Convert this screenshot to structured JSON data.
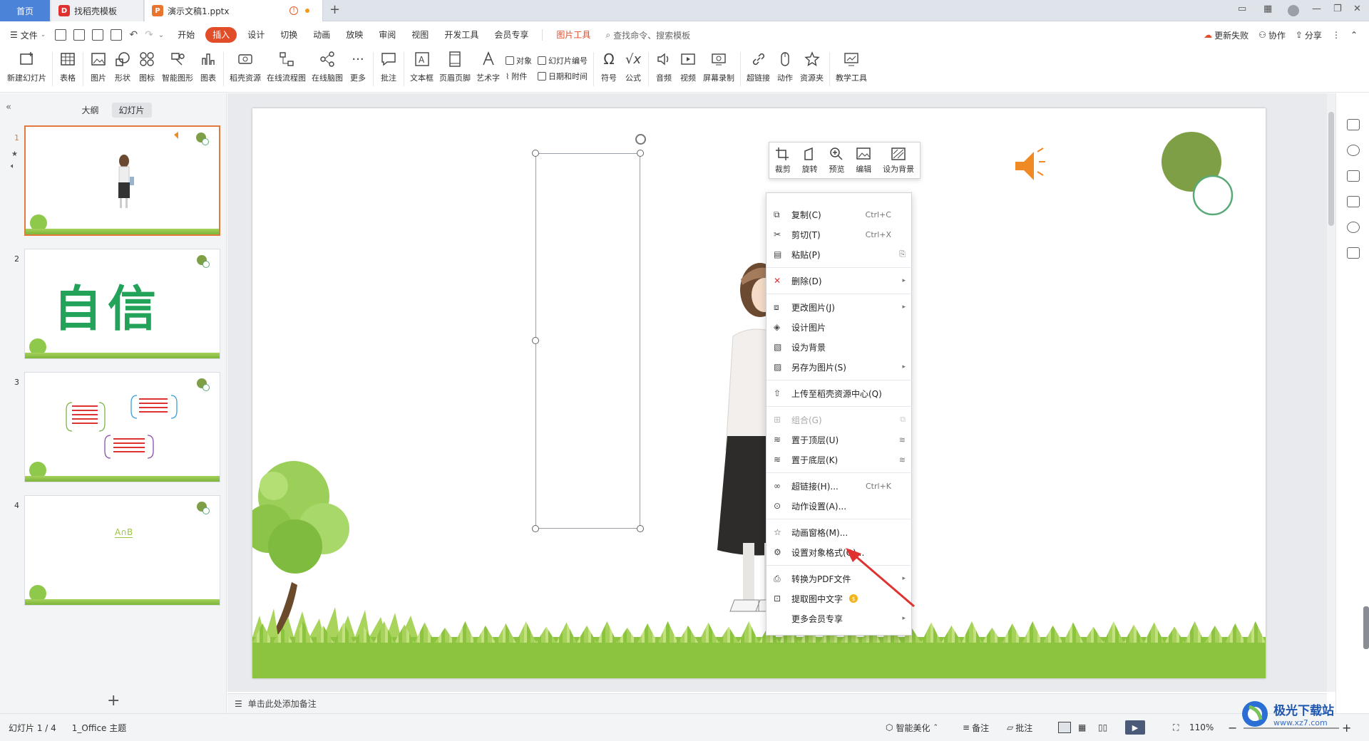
{
  "tabs": {
    "home": "首页",
    "template": "找稻壳模板",
    "document": "演示文稿1.pptx"
  },
  "menu": {
    "file": "文件",
    "tabs": [
      "开始",
      "插入",
      "设计",
      "切换",
      "动画",
      "放映",
      "审阅",
      "视图",
      "开发工具",
      "会员专享"
    ],
    "active_tab": "插入",
    "picture_tools": "图片工具",
    "search": "查找命令、搜索模板",
    "update_failed": "更新失败",
    "collaborate": "协作",
    "share": "分享"
  },
  "ribbon": {
    "new_slide": "新建幻灯片",
    "table": "表格",
    "picture": "图片",
    "shape": "形状",
    "icon": "图标",
    "smart_shape": "智能图形",
    "chart": "图表",
    "docer_res": "稻壳资源",
    "online_flow": "在线流程图",
    "online_mind": "在线脑图",
    "more": "更多",
    "comment": "批注",
    "textbox": "文本框",
    "header_footer": "页眉页脚",
    "wordart": "艺术字",
    "object": "对象",
    "attachment": "附件",
    "slide_number": "幻灯片编号",
    "date_time": "日期和时间",
    "symbol": "符号",
    "formula": "公式",
    "audio": "音频",
    "video": "视频",
    "screen_record": "屏幕录制",
    "hyperlink": "超链接",
    "action": "动作",
    "resource": "资源夹",
    "teach_tool": "教学工具"
  },
  "left_panel": {
    "outline": "大纲",
    "slides": "幻灯片",
    "slide_numbers": [
      "1",
      "2",
      "3",
      "4"
    ],
    "slide2_title": "自信",
    "slide4_title": "A∩B"
  },
  "float_toolbar": [
    "裁剪",
    "旋转",
    "预览",
    "编辑",
    "设为背景"
  ],
  "context_menu": {
    "copy": "复制(C)",
    "copy_sc": "Ctrl+C",
    "cut": "剪切(T)",
    "cut_sc": "Ctrl+X",
    "paste": "粘贴(P)",
    "delete": "删除(D)",
    "change_pic": "更改图片(J)",
    "design_pic": "设计图片",
    "set_bg": "设为背景",
    "save_as_pic": "另存为图片(S)",
    "upload": "上传至稻壳资源中心(Q)",
    "group": "组合(G)",
    "bring_front": "置于顶层(U)",
    "send_back": "置于底层(K)",
    "hyperlink": "超链接(H)...",
    "hyperlink_sc": "Ctrl+K",
    "action": "动作设置(A)...",
    "anim_pane": "动画窗格(M)...",
    "format_obj": "设置对象格式(O)...",
    "to_pdf": "转换为PDF文件",
    "extract_text": "提取图中文字",
    "more_vip": "更多会员专享"
  },
  "notes_placeholder": "单击此处添加备注",
  "status": {
    "slide_count": "幻灯片 1 / 4",
    "theme": "1_Office 主题",
    "beautify": "智能美化",
    "notes": "备注",
    "comments": "批注",
    "zoom": "110%"
  },
  "watermark": {
    "title": "极光下载站",
    "url": "www.xz7.com"
  },
  "colors": {
    "accent": "#e24d29",
    "circle_green": "#7f9f47",
    "speaker_orange": "#f08a24"
  }
}
